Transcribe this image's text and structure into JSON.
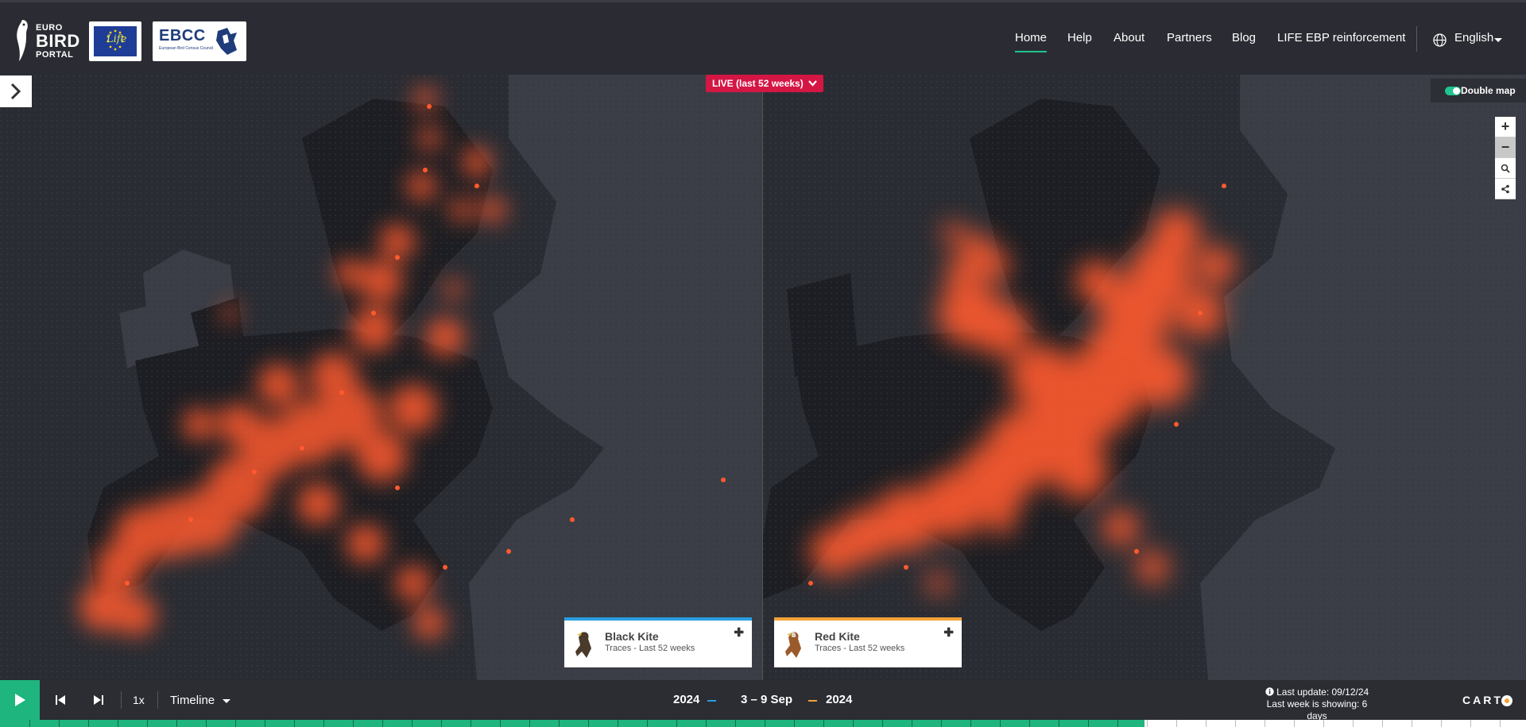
{
  "header": {
    "logo": {
      "line1": "EURO",
      "line2": "BIRD",
      "line3": "PORTAL"
    },
    "partner_logos": {
      "life": "Life",
      "ebcc": "EBCC",
      "ebcc_sub": "European Bird Census Council"
    },
    "nav": [
      {
        "label": "Home",
        "active": true
      },
      {
        "label": "Help"
      },
      {
        "label": "About"
      },
      {
        "label": "Partners"
      },
      {
        "label": "Blog"
      },
      {
        "label": "LIFE EBP reinforcement"
      }
    ],
    "language": "English"
  },
  "map_controls": {
    "live_label": "LIVE (last 52 weeks)",
    "double_map_label": "Double map",
    "double_map_on": true,
    "zoom_in": "+",
    "zoom_out": "−"
  },
  "species": [
    {
      "name": "Black Kite",
      "subtitle": "Traces - Last 52 weeks",
      "accent": "#2a9ee0"
    },
    {
      "name": "Red Kite",
      "subtitle": "Traces - Last 52 weeks",
      "accent": "#f4a23a"
    }
  ],
  "bottom_bar": {
    "speed": "1x",
    "timeline_label": "Timeline",
    "left_year": "2024",
    "week_range": "3 – 9 Sep",
    "right_year": "2024",
    "last_update": "Last update: 09/12/24",
    "last_week_note": "Last week is showing: 6 days",
    "carto": "CART"
  },
  "colors": {
    "accent_green": "#1fb57e",
    "trace_red": "#ff5a2e",
    "live_badge": "#d41645"
  }
}
